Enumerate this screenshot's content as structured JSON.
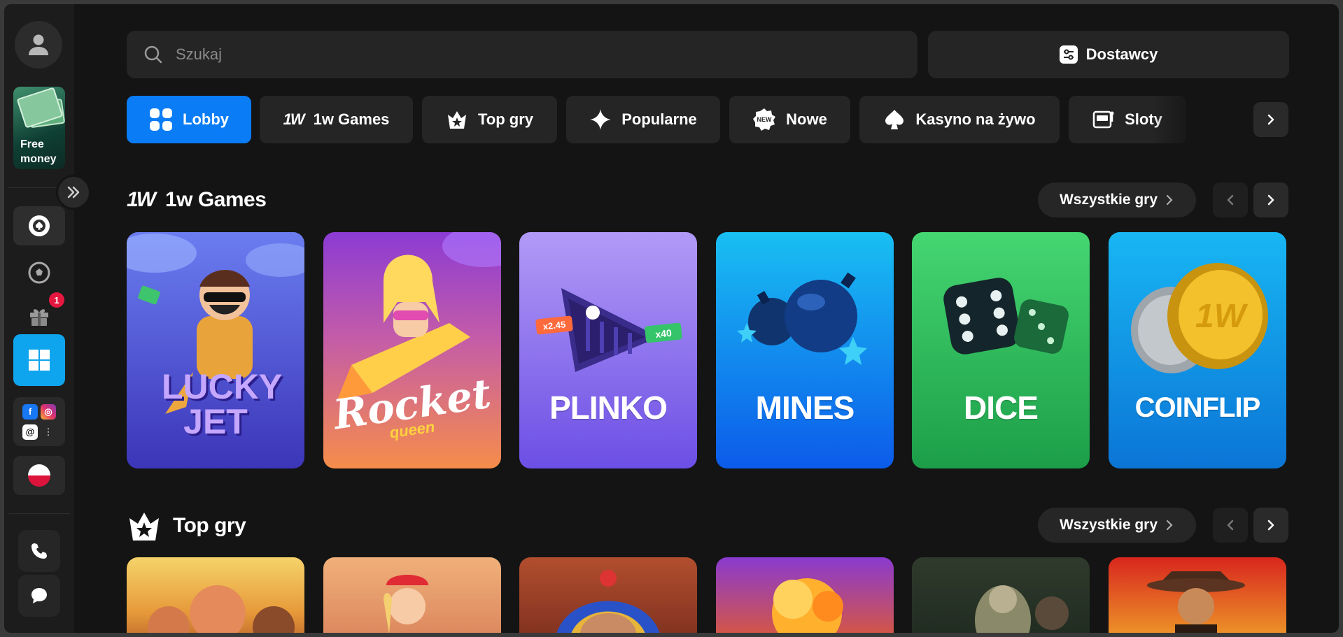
{
  "sidebar": {
    "free_money_label": "Free money",
    "notification_count": "1",
    "social": [
      "f",
      "◎",
      "@",
      "⋮"
    ]
  },
  "search": {
    "placeholder": "Szukaj"
  },
  "providers_label": "Dostawcy",
  "categories": [
    {
      "label": "Lobby",
      "icon": "grid-icon"
    },
    {
      "label": "1w Games",
      "icon": "1w-logo-icon"
    },
    {
      "label": "Top gry",
      "icon": "star-crown-icon"
    },
    {
      "label": "Popularne",
      "icon": "sparkle-icon"
    },
    {
      "label": "Nowe",
      "icon": "new-badge-icon"
    },
    {
      "label": "Kasyno na żywo",
      "icon": "spade-icon"
    },
    {
      "label": "Sloty",
      "icon": "slot-machine-icon"
    }
  ],
  "sections": [
    {
      "title": "1w Games",
      "all_label": "Wszystkie gry"
    },
    {
      "title": "Top gry",
      "all_label": "Wszystkie gry"
    }
  ],
  "games_1w": [
    {
      "name": "LUCKY JET",
      "color_top": "#5a69e8",
      "color_bottom": "#3d37b9"
    },
    {
      "name": "Rocket",
      "sub": "queen",
      "color_top": "#8e3fd6",
      "color_bottom": "#f58b44"
    },
    {
      "name": "PLINKO",
      "color_top": "#a68cf4",
      "color_bottom": "#6e4ee6"
    },
    {
      "name": "MINES",
      "color_top": "#17b5f0",
      "color_bottom": "#0d5cec"
    },
    {
      "name": "DICE",
      "color_top": "#3fd36c",
      "color_bottom": "#1fa44c"
    },
    {
      "name": "COINFLIP",
      "color_top": "#13b0f2",
      "color_bottom": "#0b76d8"
    }
  ],
  "plinko_tags": [
    "x2.45",
    "x40"
  ],
  "coin_text": "1W",
  "colors": {
    "accent": "#0a7cf5",
    "windows": "#0ea5ee",
    "badge": "#e5173f"
  }
}
